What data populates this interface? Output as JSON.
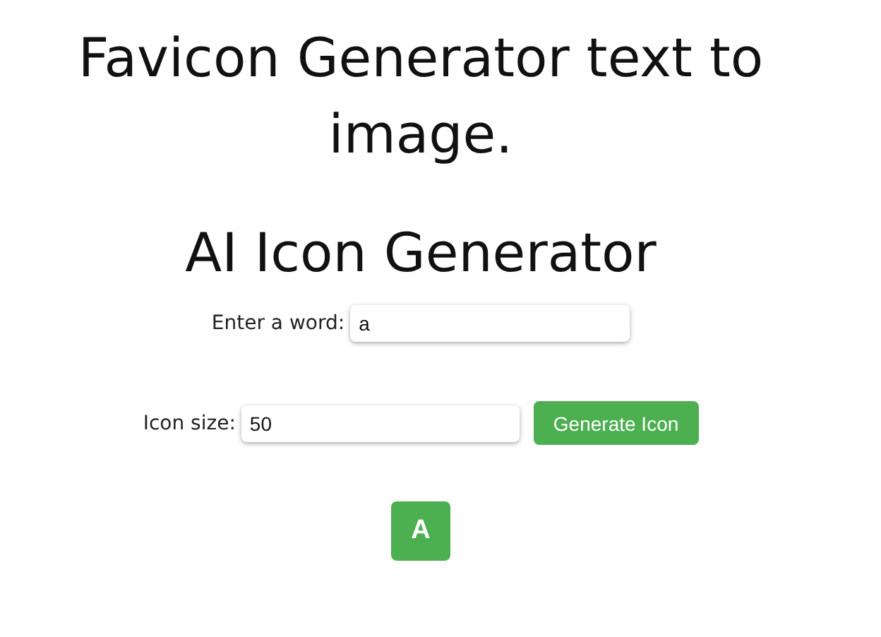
{
  "title": "Favicon Generator text to image.",
  "heading": "AI Icon Generator",
  "word_field": {
    "label": "Enter a word:",
    "value": "a"
  },
  "size_field": {
    "label": "Icon size:",
    "value": "50"
  },
  "generate_button": "Generate Icon",
  "icon_preview": {
    "text": "A",
    "color": "#4caf50"
  }
}
